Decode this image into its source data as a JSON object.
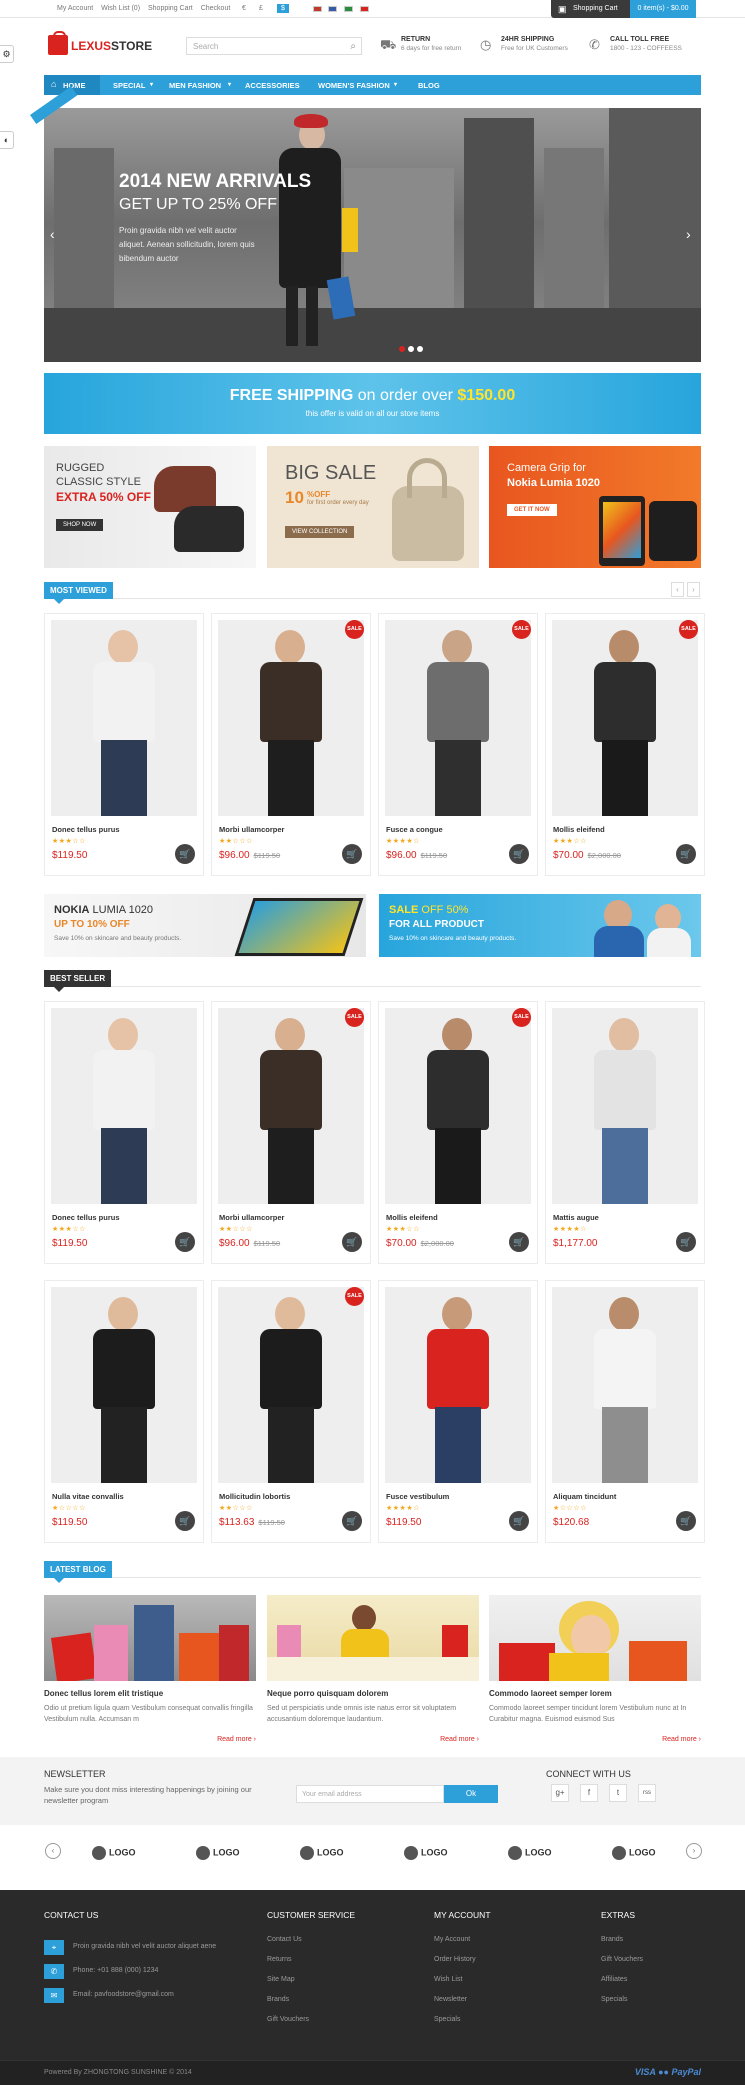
{
  "topbar": {
    "links": [
      "My Account",
      "Wish List (0)",
      "Shopping Cart",
      "Checkout"
    ],
    "currencies": [
      "€",
      "£",
      "$"
    ],
    "cart_label": "Shopping Cart",
    "cart_amount": "0 item(s) - $0.00"
  },
  "header": {
    "logo_a": "LEXUS",
    "logo_b": "STORE",
    "search_placeholder": "Search",
    "features": [
      {
        "title": "RETURN",
        "sub": "6 days for free return"
      },
      {
        "title": "24HR SHIPPING",
        "sub": "Free for UK Customers"
      },
      {
        "title": "CALL TOLL FREE",
        "sub": "1800 - 123 - COFFEESS"
      }
    ]
  },
  "nav": [
    "HOME",
    "SPECIAL",
    "MEN FASHION",
    "ACCESSORIES",
    "WOMEN'S FASHION",
    "BLOG"
  ],
  "slider": {
    "title": "2014 NEW ARRIVALS",
    "subtitle": "GET UP TO 25% OFF",
    "text": "Proin gravida nibh vel velit auctor aliquet. Aenean sollicitudin, lorem quis bibendum auctor"
  },
  "shipping": {
    "a": "FREE SHIPPING",
    "b": " on order over ",
    "c": "$150.00",
    "sub": "this offer is valid on all our store items"
  },
  "promos": [
    {
      "l1": "RUGGED",
      "l2": "CLASSIC STYLE",
      "l3": "EXTRA 50% OFF",
      "btn": "SHOP NOW"
    },
    {
      "l1": "BIG SALE",
      "l2": "10",
      "l3": "%OFF",
      "l4": "for first order every day",
      "btn": "VIEW COLLECTION"
    },
    {
      "l1": "Camera Grip for",
      "l2": "Nokia Lumia 1020",
      "btn": "GET IT NOW"
    }
  ],
  "sections": {
    "most_viewed": "MOST VIEWED",
    "best_seller": "BEST SELLER",
    "latest_blog": "LATEST BLOG"
  },
  "most_viewed": [
    {
      "name": "Donec tellus purus",
      "price": "$119.50",
      "old": "",
      "sale": false,
      "stars": "★★★☆☆"
    },
    {
      "name": "Morbi ullamcorper",
      "price": "$96.00",
      "old": "$119.50",
      "sale": true,
      "stars": "★★☆☆☆"
    },
    {
      "name": "Fusce a congue",
      "price": "$96.00",
      "old": "$119.50",
      "sale": true,
      "stars": "★★★★☆"
    },
    {
      "name": "Mollis eleifend",
      "price": "$70.00",
      "old": "$2,000.00",
      "sale": true,
      "stars": "★★★☆☆"
    }
  ],
  "mid_banners": [
    {
      "l1": "NOKIA",
      "l1b": " LUMIA 1020",
      "l2": "UP TO 10% OFF",
      "l3": "Save 10% on skincare and beauty products."
    },
    {
      "l1": "SALE",
      "l1b": " OFF 50%",
      "l2": "FOR ALL PRODUCT",
      "l3": "Save 10% on skincare and beauty products."
    }
  ],
  "best_seller": [
    {
      "name": "Donec tellus purus",
      "price": "$119.50",
      "old": "",
      "sale": false,
      "stars": "★★★☆☆"
    },
    {
      "name": "Morbi ullamcorper",
      "price": "$96.00",
      "old": "$119.50",
      "sale": true,
      "stars": "★★☆☆☆"
    },
    {
      "name": "Mollis eleifend",
      "price": "$70.00",
      "old": "$2,000.00",
      "sale": true,
      "stars": "★★★☆☆"
    },
    {
      "name": "Mattis augue",
      "price": "$1,177.00",
      "old": "",
      "sale": false,
      "stars": "★★★★☆"
    },
    {
      "name": "Nulla vitae convallis",
      "price": "$119.50",
      "old": "",
      "sale": false,
      "stars": "★☆☆☆☆"
    },
    {
      "name": "Mollicitudin lobortis",
      "price": "$113.63",
      "old": "$119.50",
      "sale": true,
      "stars": "★★☆☆☆"
    },
    {
      "name": "Fusce vestibulum",
      "price": "$119.50",
      "old": "",
      "sale": false,
      "stars": "★★★★☆"
    },
    {
      "name": "Aliquam tincidunt",
      "price": "$120.68",
      "old": "",
      "sale": false,
      "stars": "★☆☆☆☆"
    }
  ],
  "blog": [
    {
      "title": "Donec tellus lorem elit tristique",
      "text": "Odio ut pretium ligula quam Vestibulum consequat convallis fringilla Vestibulum nulla. Accumsan m",
      "more": "Read more ›"
    },
    {
      "title": "Neque porro quisquam dolorem",
      "text": "Sed ut perspiciatis unde omnis iste natus error sit voluptatem accusantium doloremque laudantium.",
      "more": "Read more ›"
    },
    {
      "title": "Commodo laoreet semper lorem",
      "text": "Commodo laoreet semper tincidunt lorem Vestibulum nunc at In Curabitur magna. Euismod euismod Sus",
      "more": "Read more ›"
    }
  ],
  "newsletter": {
    "title": "NEWSLETTER",
    "text": "Make sure you dont miss interesting happenings by joining our newsletter program",
    "placeholder": "Your email address",
    "ok": "Ok",
    "connect": "CONNECT WITH US",
    "social": [
      "g+",
      "f",
      "t",
      "rss"
    ]
  },
  "logos": [
    "LOGO",
    "LOGO",
    "LOGO",
    "LOGO",
    "LOGO",
    "LOGO"
  ],
  "footer": {
    "contact_title": "CONTACT US",
    "contact": [
      "Proin gravida nibh vel velit auctor aliquet aene",
      "Phone: +01 888 (000) 1234",
      "Email: pavfoodstore@gmail.com"
    ],
    "cols": [
      {
        "title": "CUSTOMER SERVICE",
        "items": [
          "Contact Us",
          "Returns",
          "Site Map",
          "Brands",
          "Gift Vouchers"
        ]
      },
      {
        "title": "MY ACCOUNT",
        "items": [
          "My Account",
          "Order History",
          "Wish List",
          "Newsletter",
          "Specials"
        ]
      },
      {
        "title": "EXTRAS",
        "items": [
          "Brands",
          "Gift Vouchers",
          "Affiliates",
          "Specials"
        ]
      }
    ],
    "copyright": "Powered By ZHONGTONG SUNSHINE © 2014",
    "payments": "VISA  ●●  PayPal"
  },
  "colors": {
    "accent": "#2d9fd9",
    "sale": "#d9231f",
    "dark": "#333333"
  }
}
